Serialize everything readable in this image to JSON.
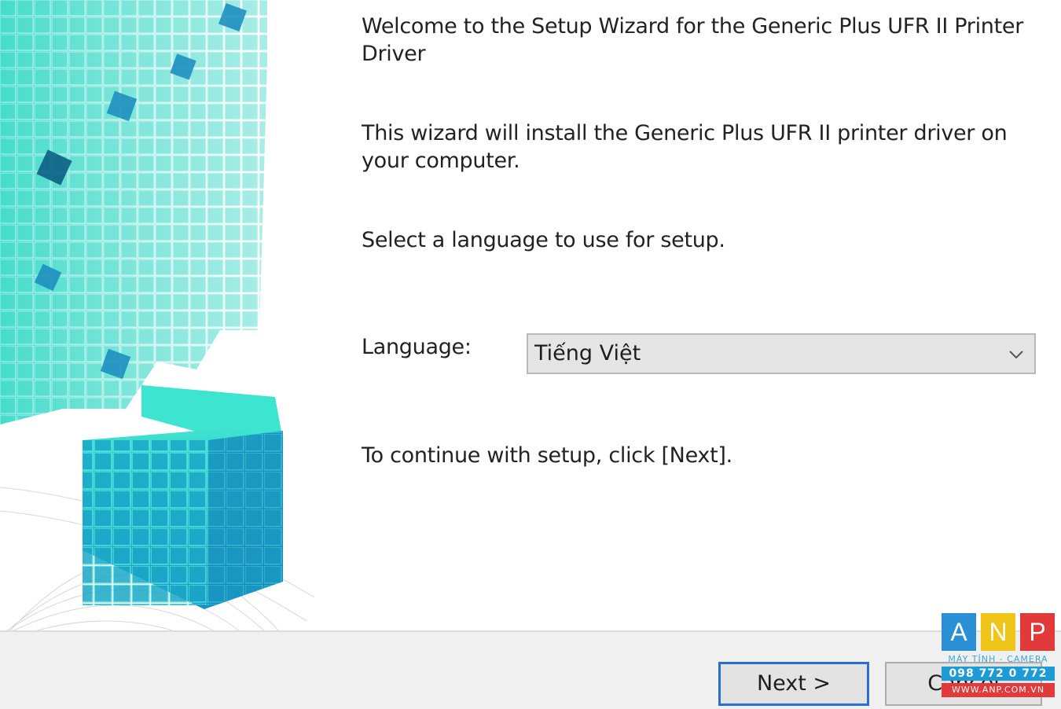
{
  "wizard": {
    "welcome_heading": "Welcome to the Setup Wizard for the Generic Plus UFR II Printer Driver",
    "install_description": "This wizard will install the Generic Plus UFR II printer driver on your computer.",
    "select_language_prompt": "Select a language to use for setup.",
    "language_label": "Language:",
    "language_selected": "Tiếng Việt",
    "continue_instruction": "To continue with setup, click [Next]."
  },
  "buttons": {
    "next_label": "Next >",
    "cancel_label": "Cancel"
  },
  "watermark": {
    "letter_a": "A",
    "letter_n": "N",
    "letter_p": "P",
    "tagline": "MÁY TÍNH - CAMERA",
    "phone": "098 772 0 772",
    "website": "WWW.ANP.COM.VN",
    "colors": {
      "a": "#2b8fd6",
      "n": "#f0c419",
      "p": "#e23a3a"
    }
  },
  "colors": {
    "accent_cyan": "#2fd3c4",
    "next_border": "#2a6fd0"
  },
  "icons": {
    "dropdown": "chevron-down-icon",
    "banner": "cube-graphic"
  }
}
